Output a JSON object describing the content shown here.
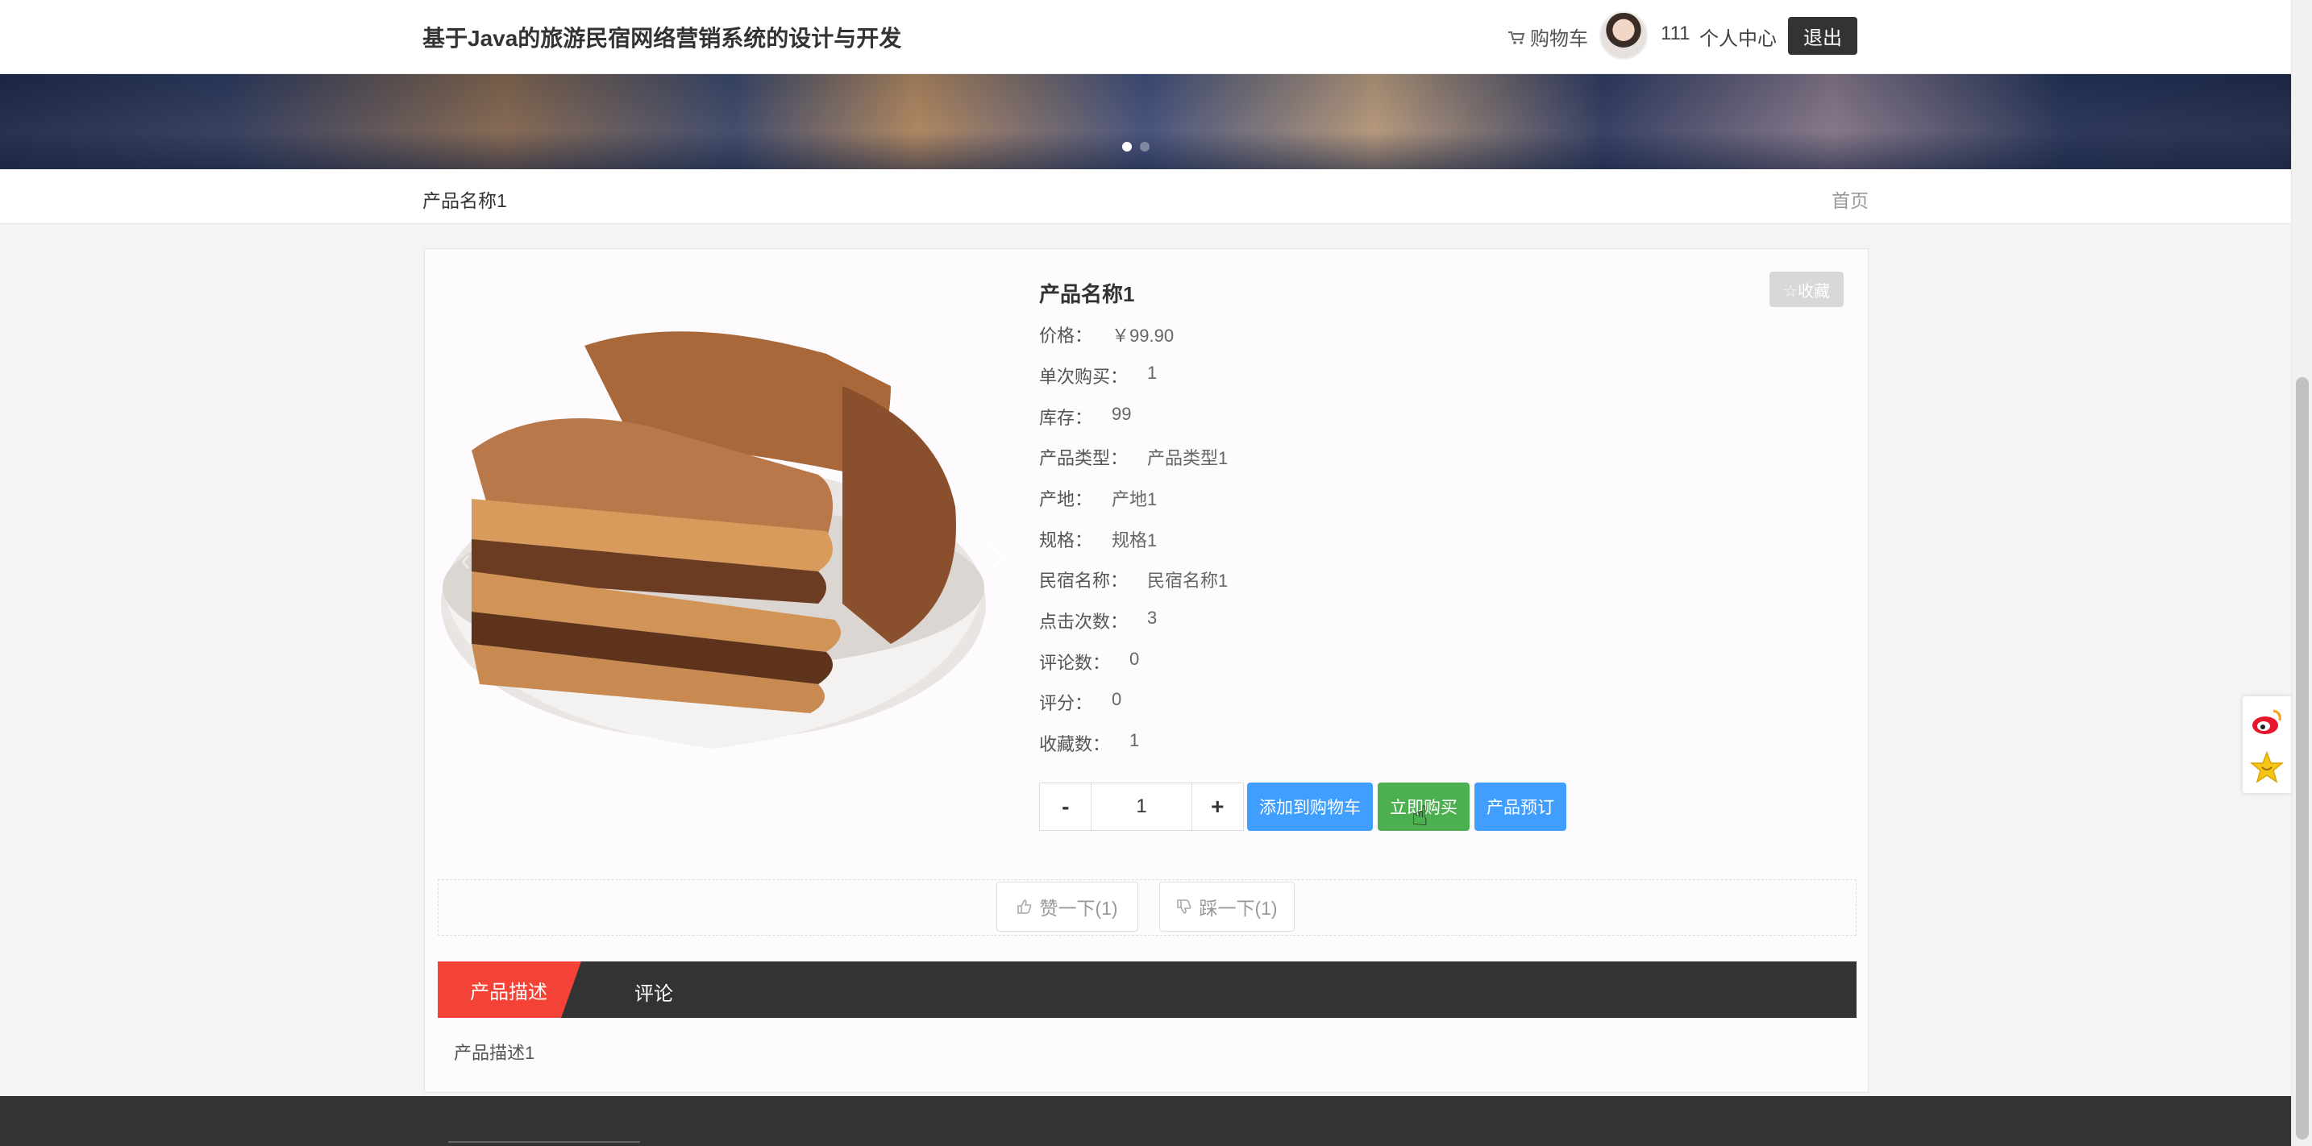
{
  "header": {
    "site_title": "基于Java的旅游民宿网络营销系统的设计与开发",
    "cart_label": "购物车",
    "username": "111",
    "personal_center": "个人中心",
    "logout": "退出"
  },
  "breadcrumb": {
    "current": "产品名称1",
    "home": "首页"
  },
  "product": {
    "name": "产品名称1",
    "favorite_label": "☆收藏",
    "details": [
      {
        "label": "价格：",
        "value": "￥99.90"
      },
      {
        "label": "单次购买：",
        "value": "1"
      },
      {
        "label": "库存：",
        "value": "99"
      },
      {
        "label": "产品类型：",
        "value": "产品类型1"
      },
      {
        "label": "产地：",
        "value": "产地1"
      },
      {
        "label": "规格：",
        "value": "规格1"
      },
      {
        "label": "民宿名称：",
        "value": "民宿名称1"
      },
      {
        "label": "点击次数：",
        "value": "3"
      },
      {
        "label": "评论数：",
        "value": "0"
      },
      {
        "label": "评分：",
        "value": "0"
      },
      {
        "label": "收藏数：",
        "value": "1"
      }
    ]
  },
  "quantity": {
    "minus": "-",
    "value": "1",
    "plus": "+"
  },
  "actions": {
    "add_to_cart": "添加到购物车",
    "buy_now": "立即购买",
    "book": "产品预订"
  },
  "votes": {
    "like": "赞一下(1)",
    "dislike": "踩一下(1)"
  },
  "tabs": {
    "description": "产品描述",
    "comments": "评论"
  },
  "description_text": "产品描述1",
  "colors": {
    "primary_blue": "#409eff",
    "buy_green": "#4caf50",
    "tab_red": "#f44336",
    "dark": "#333333"
  },
  "icons": [
    "cart-icon",
    "chevron-right-icon",
    "thumbs-up-icon",
    "thumbs-down-icon",
    "weibo-icon",
    "star-share-icon"
  ]
}
